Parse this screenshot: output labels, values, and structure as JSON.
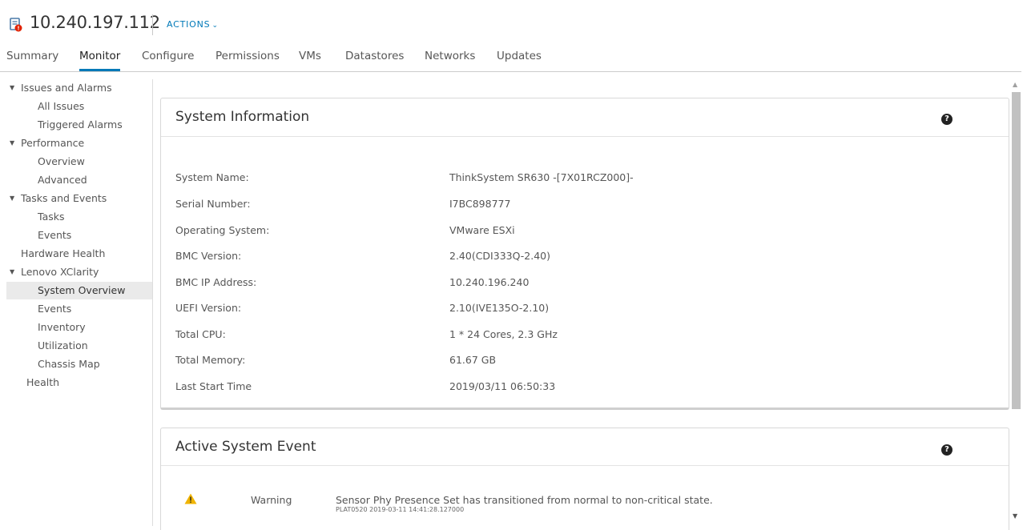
{
  "header": {
    "host_title": "10.240.197.112",
    "actions_label": "ACTIONS",
    "actions_chevron": "⌄",
    "host_icon": "host-alert-icon",
    "accent_color": "#0079b8",
    "alert_color": "#e12200"
  },
  "tabs": [
    {
      "label": "Summary"
    },
    {
      "label": "Monitor",
      "active": true
    },
    {
      "label": "Configure"
    },
    {
      "label": "Permissions"
    },
    {
      "label": "VMs"
    },
    {
      "label": "Datastores"
    },
    {
      "label": "Networks"
    },
    {
      "label": "Updates"
    }
  ],
  "sidebar": {
    "items": [
      {
        "label": "Issues and Alarms",
        "expandable": true
      },
      {
        "label": "All Issues"
      },
      {
        "label": "Triggered Alarms"
      },
      {
        "label": "Performance",
        "expandable": true
      },
      {
        "label": "Overview"
      },
      {
        "label": "Advanced"
      },
      {
        "label": "Tasks and Events",
        "expandable": true
      },
      {
        "label": "Tasks"
      },
      {
        "label": "Events"
      },
      {
        "label": "Hardware Health"
      },
      {
        "label": "Lenovo XClarity",
        "expandable": true
      },
      {
        "label": "System Overview",
        "selected": true
      },
      {
        "label": "Events"
      },
      {
        "label": "Inventory"
      },
      {
        "label": "Utilization"
      },
      {
        "label": "Chassis Map"
      },
      {
        "label": "Health"
      }
    ]
  },
  "system_info": {
    "title": "System Information",
    "help_glyph": "?",
    "rows": [
      {
        "label": "System Name:",
        "value": "ThinkSystem SR630 -[7X01RCZ000]-"
      },
      {
        "label": "Serial Number:",
        "value": "I7BC898777"
      },
      {
        "label": "Operating System:",
        "value": "VMware ESXi"
      },
      {
        "label": "BMC Version:",
        "value": "2.40(CDI333Q-2.40)"
      },
      {
        "label": "BMC IP Address:",
        "value": "10.240.196.240"
      },
      {
        "label": "UEFI Version:",
        "value": "2.10(IVE135O-2.10)"
      },
      {
        "label": "Total CPU:",
        "value": "1 * 24 Cores, 2.3 GHz"
      },
      {
        "label": "Total Memory:",
        "value": "61.67 GB"
      },
      {
        "label": "Last Start Time",
        "value": "2019/03/11 06:50:33"
      }
    ]
  },
  "active_event": {
    "title": "Active System Event",
    "help_glyph": "?",
    "severity": "Warning",
    "message": "Sensor Phy Presence Set has transitioned from normal to non-critical state.",
    "detail": "PLAT0520 2019-03-11 14:41:28.127000",
    "warning_color": "#f0b400"
  },
  "scrollbar": {
    "up_glyph": "▲",
    "down_glyph": "▼"
  }
}
